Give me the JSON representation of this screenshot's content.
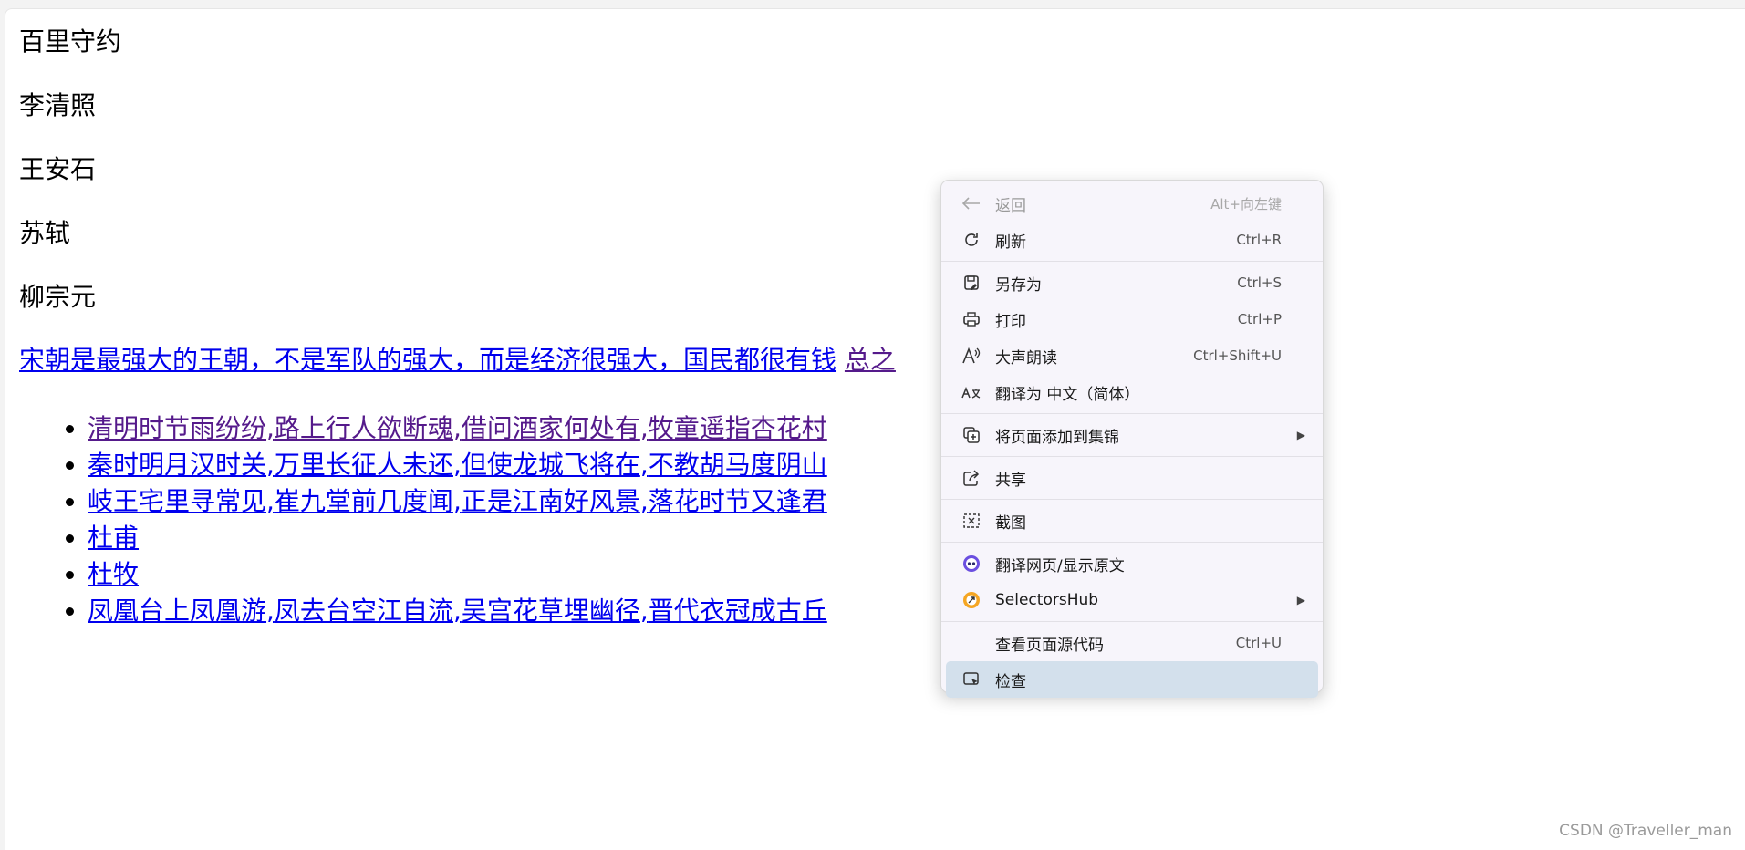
{
  "headings": [
    "百里守约",
    "李清照",
    "王安石",
    "苏轼",
    "柳宗元"
  ],
  "link_line": {
    "main": "宋朝是最强大的王朝，不是军队的强大，而是经济很强大，国民都很有钱",
    "partial": "总之"
  },
  "poems": [
    [
      "清明时节雨纷纷",
      ",",
      "路上行人欲断魂",
      ",",
      "借问酒家何处有",
      ",",
      "牧童遥指杏花村"
    ],
    [
      "秦时明月汉时关",
      ",",
      "万里长征人未还",
      ",",
      "但使龙城飞将在",
      ",",
      "不教胡马度阴山"
    ],
    [
      "岐王宅里寻常见",
      ",",
      "崔九堂前几度闻",
      ",",
      "正是江南好风景",
      ",",
      "落花时节又逢君"
    ],
    [
      "杜甫"
    ],
    [
      "杜牧"
    ],
    [
      "凤凰台上凤凰游",
      ",",
      "凤去台空江自流",
      ",",
      "吴宫花草埋幽径",
      ",",
      "晋代衣冠成古丘"
    ]
  ],
  "context_menu": {
    "back": {
      "label": "返回",
      "shortcut": "Alt+向左键",
      "icon": "back-arrow-icon"
    },
    "refresh": {
      "label": "刷新",
      "shortcut": "Ctrl+R",
      "icon": "refresh-icon"
    },
    "save_as": {
      "label": "另存为",
      "shortcut": "Ctrl+S",
      "icon": "save-icon"
    },
    "print": {
      "label": "打印",
      "shortcut": "Ctrl+P",
      "icon": "printer-icon"
    },
    "read_aloud": {
      "label": "大声朗读",
      "shortcut": "Ctrl+Shift+U",
      "icon": "read-aloud-icon"
    },
    "translate": {
      "label": "翻译为 中文（简体）",
      "icon": "translate-icon"
    },
    "add_collection": {
      "label": "将页面添加到集锦",
      "icon": "collection-icon"
    },
    "share": {
      "label": "共享",
      "icon": "share-icon"
    },
    "screenshot": {
      "label": "截图",
      "icon": "screenshot-icon"
    },
    "translate_page": {
      "label": "翻译网页/显示原文",
      "icon": "translate-extension-icon"
    },
    "selectorshub": {
      "label": "SelectorsHub",
      "icon": "selectorshub-icon"
    },
    "view_source": {
      "label": "查看页面源代码",
      "shortcut": "Ctrl+U"
    },
    "inspect": {
      "label": "检查",
      "icon": "inspect-icon"
    }
  },
  "watermark": "CSDN @Traveller_man",
  "colors": {
    "link": "#0000ee",
    "visited": "#551a8b",
    "menu_highlight": "#d3e0ec"
  }
}
